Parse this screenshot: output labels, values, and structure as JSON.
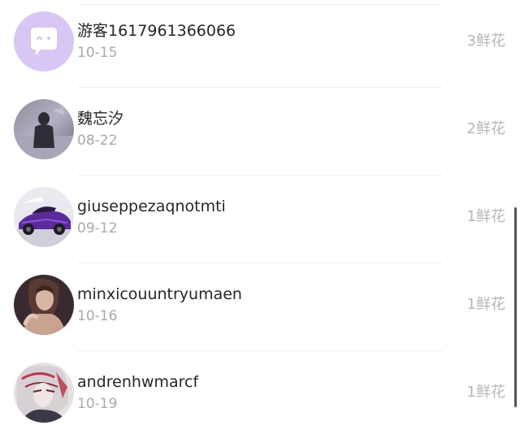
{
  "list": {
    "rows": [
      {
        "name": "游客1617961366066",
        "date": "10-15",
        "count": "3鲜花",
        "avatar_icon": "chat-bubble-icon"
      },
      {
        "name": "魏忘汐",
        "date": "08-22",
        "count": "2鲜花",
        "avatar_icon": "user-photo"
      },
      {
        "name": "giuseppezaqnotmti",
        "date": "09-12",
        "count": "1鲜花",
        "avatar_icon": "car-photo"
      },
      {
        "name": "minxicouuntryumaen",
        "date": "10-16",
        "count": "1鲜花",
        "avatar_icon": "user-photo"
      },
      {
        "name": "andrenhwmarcf",
        "date": "10-19",
        "count": "1鲜花",
        "avatar_icon": "user-photo"
      }
    ]
  },
  "colors": {
    "name_text": "#262626",
    "date_text": "#a9a9a9",
    "count_text": "#b6b6b6",
    "guest_avatar_bg": "#d7c5f3"
  }
}
